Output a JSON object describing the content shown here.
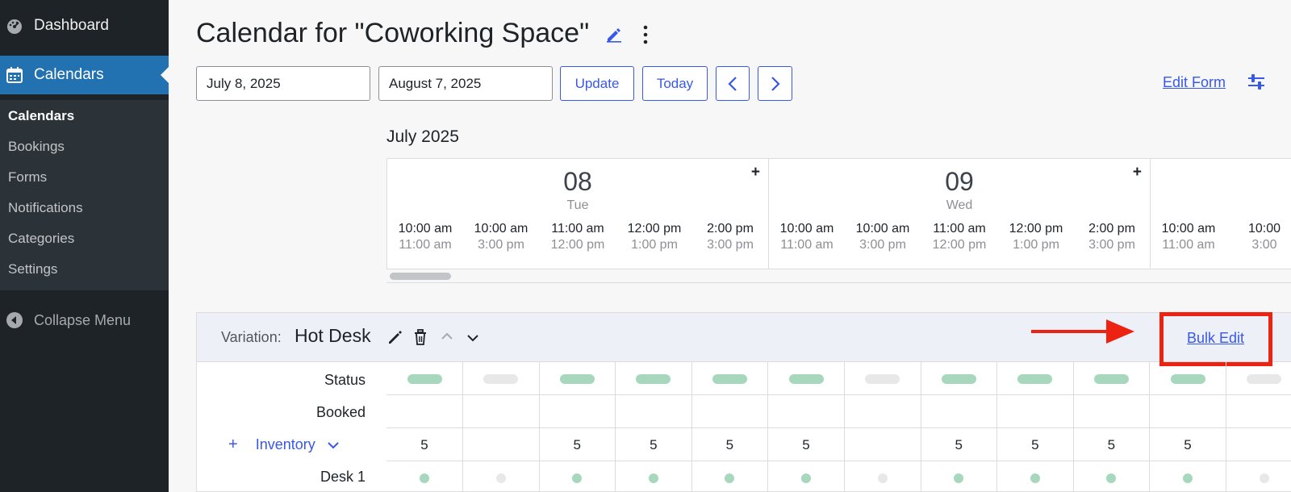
{
  "sidebar": {
    "dashboard": "Dashboard",
    "calendars": "Calendars",
    "submenu": [
      "Calendars",
      "Bookings",
      "Forms",
      "Notifications",
      "Categories",
      "Settings"
    ],
    "collapse": "Collapse Menu"
  },
  "header": {
    "title": "Calendar for \"Coworking Space\"",
    "start_date": "July 8, 2025",
    "end_date": "August 7, 2025",
    "update_label": "Update",
    "today_label": "Today",
    "edit_form_label": "Edit Form"
  },
  "calendar": {
    "month": "July 2025",
    "days": [
      {
        "num": "08",
        "name": "Tue",
        "plus": "+",
        "slots": [
          {
            "start": "10:00 am",
            "end": "11:00 am"
          },
          {
            "start": "10:00 am",
            "end": "3:00 pm"
          },
          {
            "start": "11:00 am",
            "end": "12:00 pm"
          },
          {
            "start": "12:00 pm",
            "end": "1:00 pm"
          },
          {
            "start": "2:00 pm",
            "end": "3:00 pm"
          }
        ]
      },
      {
        "num": "09",
        "name": "Wed",
        "plus": "+",
        "slots": [
          {
            "start": "10:00 am",
            "end": "11:00 am"
          },
          {
            "start": "10:00 am",
            "end": "3:00 pm"
          },
          {
            "start": "11:00 am",
            "end": "12:00 pm"
          },
          {
            "start": "12:00 pm",
            "end": "1:00 pm"
          },
          {
            "start": "2:00 pm",
            "end": "3:00 pm"
          }
        ]
      },
      {
        "num": "",
        "name": "",
        "plus": "",
        "slots": [
          {
            "start": "10:00 am",
            "end": "11:00 am"
          },
          {
            "start": "10:00",
            "end": "3:00"
          }
        ]
      }
    ]
  },
  "variation": {
    "label": "Variation:",
    "name": "Hot Desk",
    "bulk_edit_label": "Bulk Edit",
    "rows": {
      "status": "Status",
      "booked": "Booked",
      "inventory": "Inventory",
      "desk1": "Desk 1"
    },
    "add_symbol": "+",
    "status_values": [
      "available",
      "unavailable",
      "available",
      "available",
      "available",
      "available",
      "unavailable",
      "available",
      "available",
      "available",
      "available",
      "unavailable"
    ],
    "inventory_values": [
      "5",
      "",
      "5",
      "5",
      "5",
      "5",
      "",
      "5",
      "5",
      "5",
      "5",
      ""
    ],
    "desk1_values": [
      "available",
      "unavailable",
      "available",
      "available",
      "available",
      "available",
      "unavailable",
      "available",
      "available",
      "available",
      "available",
      "unavailable"
    ]
  },
  "colors": {
    "sidebar_bg": "#1d2327",
    "active_menu": "#2271b1",
    "accent": "#3858e9",
    "available": "#a7d8bd",
    "unavailable": "#e8e8e9",
    "annotation": "#ee2211"
  }
}
